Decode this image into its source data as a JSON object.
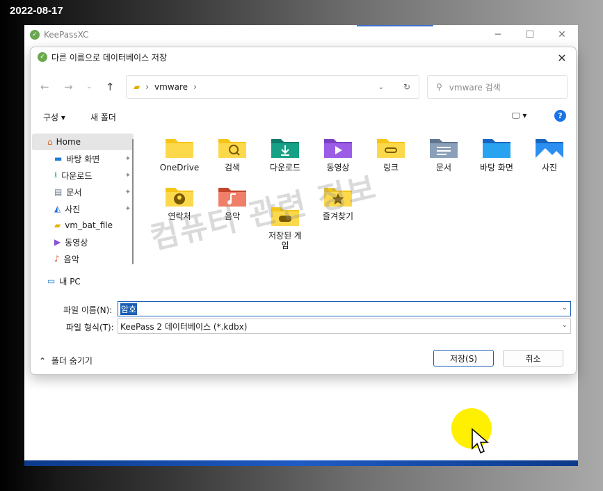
{
  "date": "2022-08-17",
  "kp_window": {
    "title": "KeePassXC"
  },
  "dialog": {
    "title": "다른 이름으로 데이터베이스 저장",
    "address": {
      "crumb": "vmware"
    },
    "search_placeholder": "vmware 검색",
    "toolbar": {
      "organize": "구성",
      "new_folder": "새 폴더"
    },
    "nav_items": [
      {
        "label": "Home",
        "icon": "home-icon"
      },
      {
        "label": "바탕 화면",
        "icon": "desktop-icon"
      },
      {
        "label": "다운로드",
        "icon": "download-icon"
      },
      {
        "label": "문서",
        "icon": "document-icon"
      },
      {
        "label": "사진",
        "icon": "picture-icon"
      },
      {
        "label": "vm_bat_file",
        "icon": "folder-icon"
      },
      {
        "label": "동영상",
        "icon": "video-icon"
      },
      {
        "label": "음악",
        "icon": "music-icon"
      },
      {
        "label": "내 PC",
        "icon": "pc-icon"
      }
    ],
    "files": [
      {
        "label": "OneDrive",
        "icon": "folder-icon"
      },
      {
        "label": "검색",
        "icon": "search-folder-icon"
      },
      {
        "label": "다운로드",
        "icon": "download-folder-icon"
      },
      {
        "label": "동영상",
        "icon": "video-folder-icon"
      },
      {
        "label": "링크",
        "icon": "link-folder-icon"
      },
      {
        "label": "문서",
        "icon": "document-folder-icon"
      },
      {
        "label": "바탕 화면",
        "icon": "desktop-folder-icon"
      },
      {
        "label": "사진",
        "icon": "picture-folder-icon"
      },
      {
        "label": "연락처",
        "icon": "contacts-folder-icon"
      },
      {
        "label": "음악",
        "icon": "music-folder-icon"
      },
      {
        "label": "저장된 게\n임",
        "icon": "games-folder-icon"
      },
      {
        "label": "즐겨찾기",
        "icon": "favorites-folder-icon"
      }
    ],
    "filename_label": "파일 이름(N):",
    "filename_value": "암호",
    "filetype_label": "파일 형식(T):",
    "filetype_value": "KeePass 2 데이터베이스 (*.kdbx)",
    "hide_folders": "폴더 숨기기",
    "save_button": "저장(S)",
    "cancel_button": "취소"
  },
  "watermark": "컴퓨터 관련 정보",
  "colors": {
    "accent": "#1a5fb4",
    "help": "#1a73e8",
    "cursor_highlight": "#ffef00"
  }
}
